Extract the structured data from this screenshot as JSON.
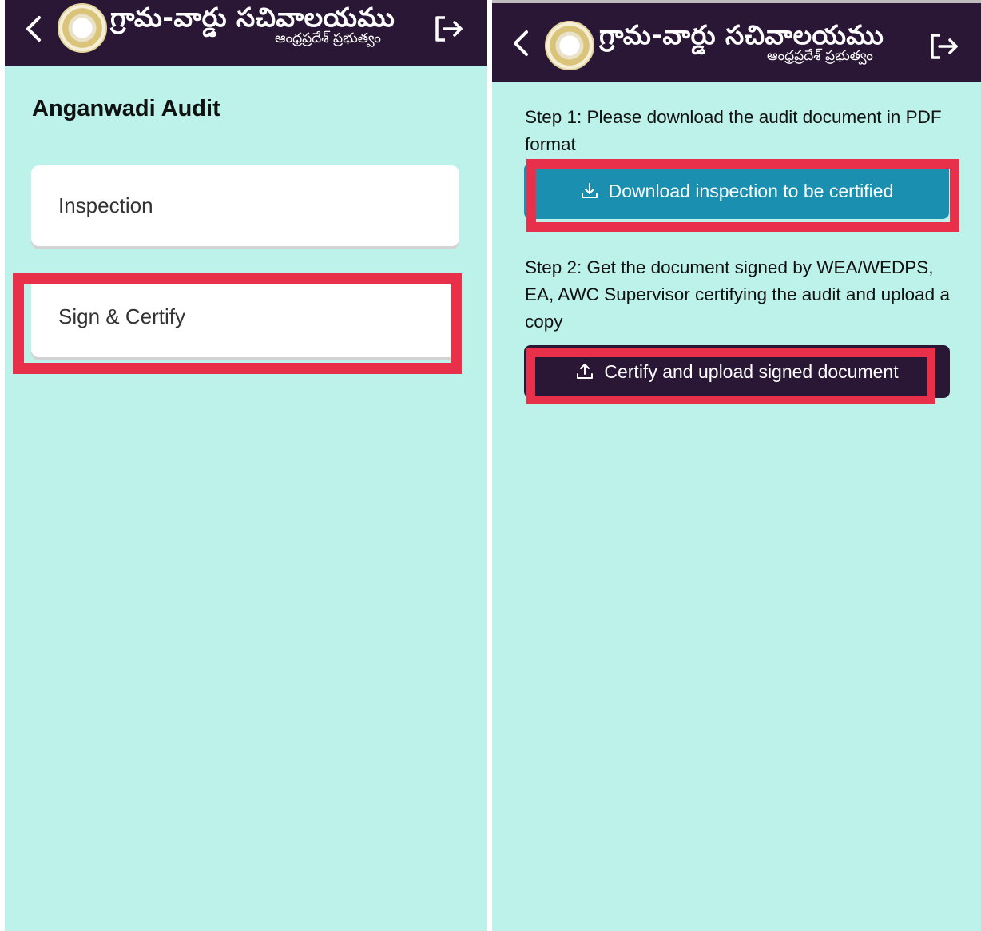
{
  "brand": {
    "title": "గ్రామ-వార్డు సచివాలయము",
    "subtitle": "ఆంధ్రప్రదేశ్ ప్రభుత్వం"
  },
  "icons": {
    "back": "chevron-left-icon",
    "logout": "logout-icon",
    "download": "download-icon",
    "upload": "upload-icon",
    "emblem": "state-emblem-logo"
  },
  "left_screen": {
    "page_title": "Anganwadi Audit",
    "options": [
      {
        "label": "Inspection"
      },
      {
        "label": "Sign & Certify"
      }
    ]
  },
  "right_screen": {
    "step1_text": "Step 1: Please download the audit document in PDF format",
    "download_button_label": "Download inspection to be certified",
    "step2_text": "Step 2: Get the document signed by WEA/WEDPS, EA, AWC Supervisor certifying the audit and upload a copy",
    "certify_button_label": "Certify and upload signed document"
  },
  "colors": {
    "background": "#bdf2ea",
    "app_bar": "#2a1735",
    "download_button": "#1a8fb0",
    "certify_button": "#2a1735",
    "highlight": "#e8304b"
  }
}
